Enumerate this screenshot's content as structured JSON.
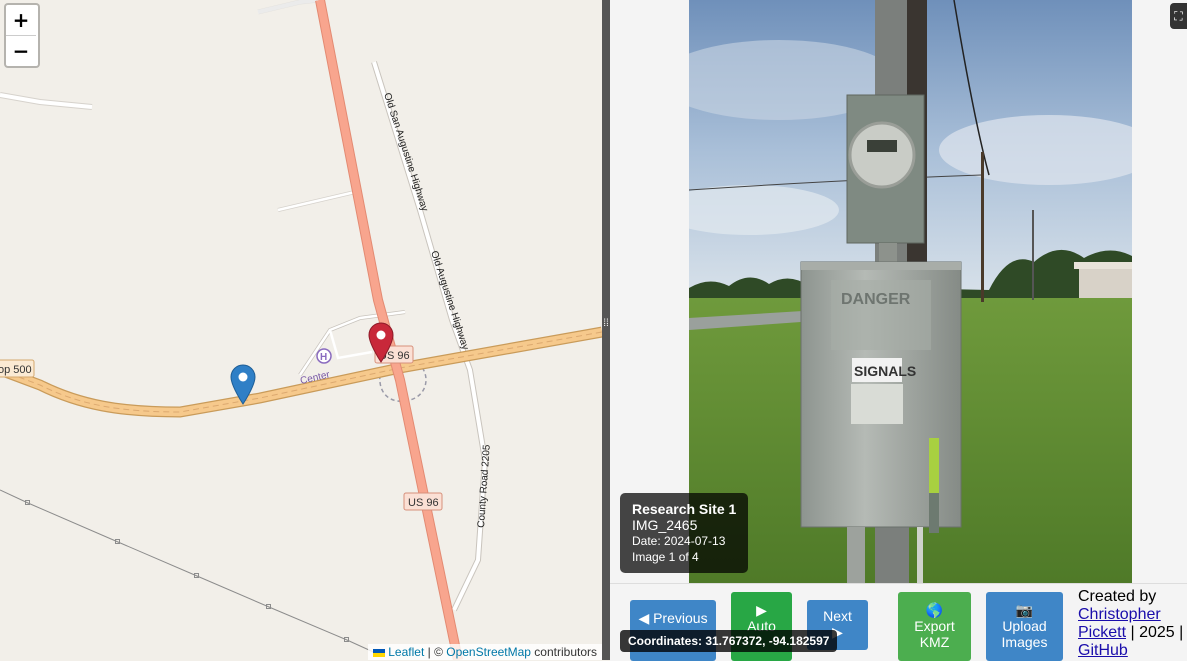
{
  "map": {
    "zoom_in": "+",
    "zoom_out": "−",
    "labels": {
      "old_san_augustine": "Old San Augustine Highway",
      "old_augustine": "Old Augustine Highway",
      "us96_top": "US 96",
      "us96_bottom": "US 96",
      "loop500": "op 500",
      "center": "Center",
      "county_road": "County Road 2205",
      "hospital": "H"
    },
    "attribution": {
      "leaflet": "Leaflet",
      "sep": " | © ",
      "osm": "OpenStreetMap",
      "contributors": " contributors"
    },
    "markers": [
      {
        "name": "blue-marker",
        "color": "#2f7fc6"
      },
      {
        "name": "red-marker",
        "color": "#c8283a"
      }
    ]
  },
  "viewer": {
    "fullscreen_icon": "⛶",
    "info": {
      "site": "Research Site 1",
      "image_name": "IMG_2465",
      "date": "Date: 2024-07-13",
      "index": "Image 1 of 4"
    },
    "photo_text": {
      "danger": "DANGER",
      "signals": "SIGNALS"
    },
    "buttons": {
      "previous": "◀ Previous",
      "auto_icon": "▶",
      "auto": "Auto",
      "next": "Next",
      "next_icon": "▶",
      "export_icon": "🌎",
      "export": "Export",
      "export2": "KMZ",
      "upload_icon": "📷",
      "upload": "Upload",
      "upload2": "Images"
    },
    "coords": "Coordinates: 31.767372, -94.182597",
    "credits": {
      "created_by": "Created by",
      "author": "Christopher Pickett",
      "year": " | 2025 | ",
      "github": "GitHub"
    }
  },
  "colors": {
    "us96": "#f8a58e",
    "loop": "#f6c98c",
    "blue_button": "#3f86c7",
    "green_button": "#28a745"
  }
}
